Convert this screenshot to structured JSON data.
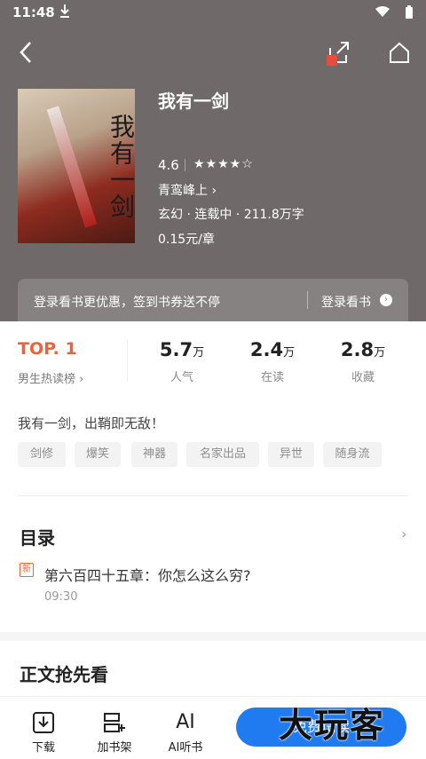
{
  "status": {
    "time": "11:48"
  },
  "book": {
    "title": "我有一剑",
    "rating": "4.6",
    "stars": "★★★★☆",
    "author": "青鸾峰上 ›",
    "meta": "玄幻 · 连载中 · 211.8万字",
    "price": "0.15元/章"
  },
  "login_bar": {
    "message": "登录看书更优惠，签到书券送不停",
    "button": "登录看书",
    "arrow": "›"
  },
  "stats": {
    "top": "TOP. 1",
    "top_label": "男生热读榜 ›",
    "popularity": {
      "value": "5.7",
      "unit": "万",
      "label": "人气"
    },
    "reading": {
      "value": "2.4",
      "unit": "万",
      "label": "在读"
    },
    "favorites": {
      "value": "2.8",
      "unit": "万",
      "label": "收藏"
    }
  },
  "slogan": "我有一剑，出鞘即无敌！",
  "tags": [
    "剑修",
    "爆笑",
    "神器",
    "名家出品",
    "异世",
    "随身流"
  ],
  "toc": {
    "title": "目录",
    "arrow": "›",
    "new_badge": "新",
    "latest_chapter": "第六百四十五章：你怎么这么穷?",
    "latest_time": "09:30"
  },
  "section2_title": "正文抢先看",
  "bottom": {
    "download": "下载",
    "add_shelf": "加书架",
    "ai_icon_text": "AI",
    "ai_listen": "AI听书",
    "read_button": "免费试读"
  },
  "watermark": "大玩客",
  "colors": {
    "hero_bg": "#6f6a69",
    "accent": "#e8643c",
    "primary_button": "#1f7bef"
  }
}
